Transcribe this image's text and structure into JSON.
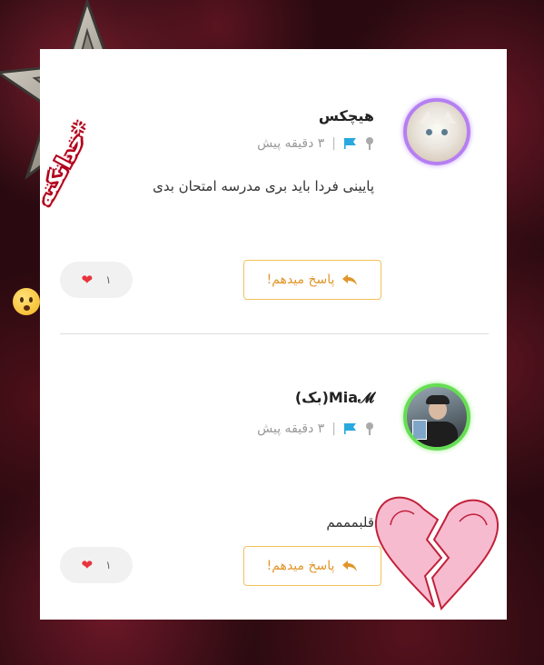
{
  "comments": [
    {
      "username": "هیچکس",
      "time": "۳ دقیقه پیش",
      "separator": "|",
      "text": "پایینی فردا باید بری مدرسه امتحان بدی",
      "reply_label": "پاسخ میدهم!",
      "like_count": "۱",
      "avatar_ring_color": "#b57ff2"
    },
    {
      "username": "Mia𝓜(بک)",
      "time": "۳ دقیقه پیش",
      "separator": "|",
      "text": "قلبمممم",
      "reply_label": "پاسخ میدهم!",
      "like_count": "۱",
      "avatar_ring_color": "#66dd55"
    }
  ],
  "stickers": {
    "text": "*خدانکنه"
  },
  "colors": {
    "accent": "#f1c25c",
    "accent_text": "#e0962a",
    "flag": "#29a8e0",
    "heart": "#e8343c"
  },
  "icons": [
    "map-pin-icon",
    "flag-icon",
    "reply-arrow-icon",
    "heart-icon",
    "star-sticker-icon",
    "broken-heart-sticker-icon",
    "worried-face-emoji-icon"
  ]
}
